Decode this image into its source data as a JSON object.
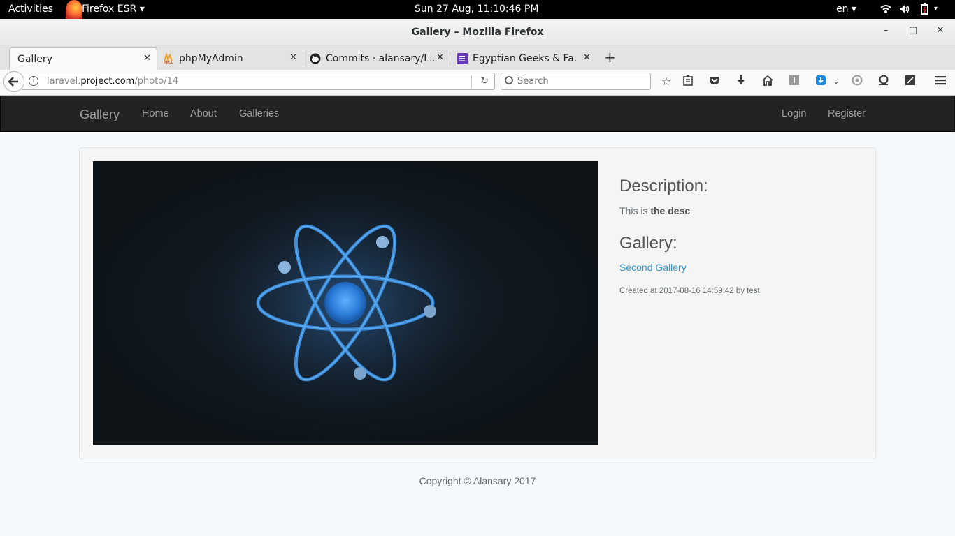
{
  "system": {
    "activities": "Activities",
    "app_menu": "Firefox ESR ▾",
    "clock": "Sun 27 Aug, 11:10:46 PM",
    "lang": "en ▾"
  },
  "window": {
    "title": "Gallery – Mozilla Firefox",
    "minimize": "–",
    "maximize": "□",
    "close": "✕"
  },
  "tabs": [
    {
      "label": "Gallery",
      "icon": "none"
    },
    {
      "label": "phpMyAdmin",
      "icon": "pma-icon"
    },
    {
      "label": "Commits · alansary/L...",
      "icon": "github-icon"
    },
    {
      "label": "Egyptian Geeks & Fa...",
      "icon": "list-icon"
    }
  ],
  "toolbar": {
    "url_host_prefix": "laravel.",
    "url_host_main": "project.com",
    "url_path": "/photo/14",
    "search_placeholder": "Search",
    "new_tab": "+"
  },
  "site": {
    "brand": "Gallery",
    "nav": [
      "Home",
      "About",
      "Galleries"
    ],
    "auth": [
      "Login",
      "Register"
    ]
  },
  "photo_detail": {
    "description_heading": "Description:",
    "description_prefix": "This is ",
    "description_bold": "the desc",
    "gallery_heading": "Gallery:",
    "gallery_link": "Second Gallery",
    "created": "Created at 2017-08-16 14:59:42 by test"
  },
  "footer": "Copyright © Alansary 2017",
  "colors": {
    "navbar_bg": "#222222",
    "link": "#3097d1",
    "atom_blue": "#3a8fe0"
  }
}
